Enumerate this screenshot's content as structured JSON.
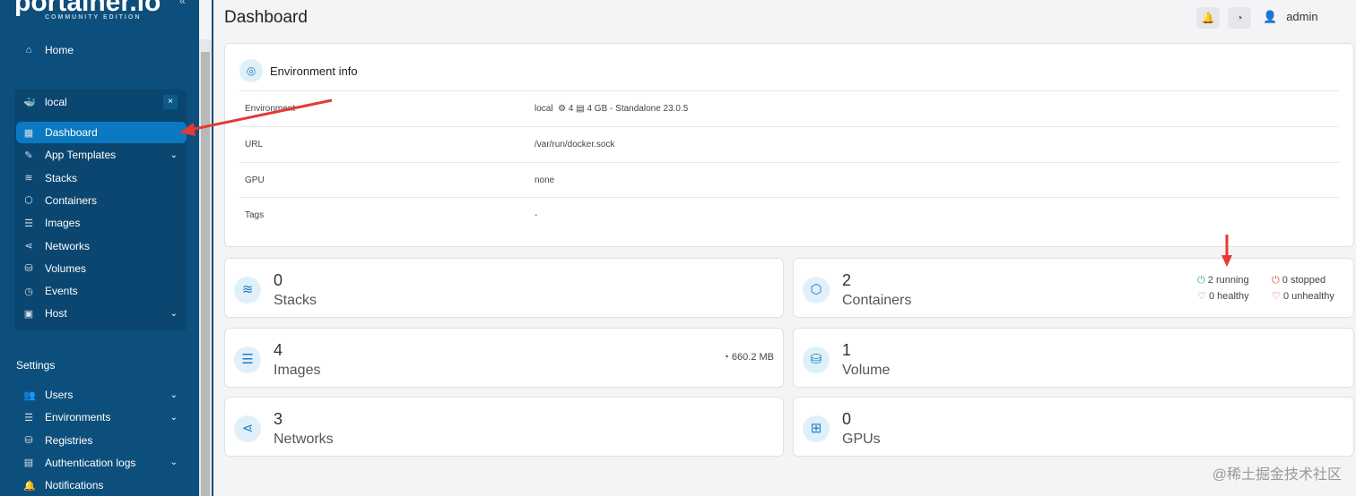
{
  "sidebar": {
    "logo": "portainer.io",
    "edition": "COMMUNITY EDITION",
    "home": "Home",
    "env_name": "local",
    "env_items": [
      {
        "label": "Dashboard",
        "icon": "layout-icon"
      },
      {
        "label": "App Templates",
        "icon": "edit-icon",
        "chevron": true
      },
      {
        "label": "Stacks",
        "icon": "layers-icon"
      },
      {
        "label": "Containers",
        "icon": "box-icon"
      },
      {
        "label": "Images",
        "icon": "list-icon"
      },
      {
        "label": "Networks",
        "icon": "share-icon"
      },
      {
        "label": "Volumes",
        "icon": "database-icon"
      },
      {
        "label": "Events",
        "icon": "clock-icon"
      },
      {
        "label": "Host",
        "icon": "host-icon",
        "chevron": true
      }
    ],
    "settings_title": "Settings",
    "settings_items": [
      {
        "label": "Users",
        "chevron": true
      },
      {
        "label": "Environments",
        "chevron": true
      },
      {
        "label": "Registries"
      },
      {
        "label": "Authentication logs",
        "chevron": true
      },
      {
        "label": "Notifications"
      }
    ]
  },
  "header": {
    "title": "Dashboard",
    "user": "admin"
  },
  "env_info": {
    "title": "Environment info",
    "rows": [
      {
        "key": "Environment",
        "value": "local",
        "cpu": "4",
        "memory": "4 GB",
        "mode": "- Standalone 23.0.5"
      },
      {
        "key": "URL",
        "value": "/var/run/docker.sock"
      },
      {
        "key": "GPU",
        "value": "none"
      },
      {
        "key": "Tags",
        "value": "-"
      }
    ]
  },
  "tiles": {
    "stacks": {
      "count": "0",
      "label": "Stacks"
    },
    "containers": {
      "count": "2",
      "label": "Containers",
      "running": "2 running",
      "stopped": "0 stopped",
      "healthy": "0 healthy",
      "unhealthy": "0 unhealthy"
    },
    "images": {
      "count": "4",
      "label": "Images",
      "size": "660.2 MB"
    },
    "volumes": {
      "count": "1",
      "label": "Volume"
    },
    "networks": {
      "count": "3",
      "label": "Networks"
    },
    "gpus": {
      "count": "0",
      "label": "GPUs"
    }
  },
  "watermark": "@稀土掘金技术社区",
  "colors": {
    "sidebar": "#0d4f7c",
    "active": "#0b79c1",
    "accent": "#1d7cc2",
    "running": "#3cb371",
    "stopped": "#d9534f",
    "annotation": "#e53935"
  }
}
